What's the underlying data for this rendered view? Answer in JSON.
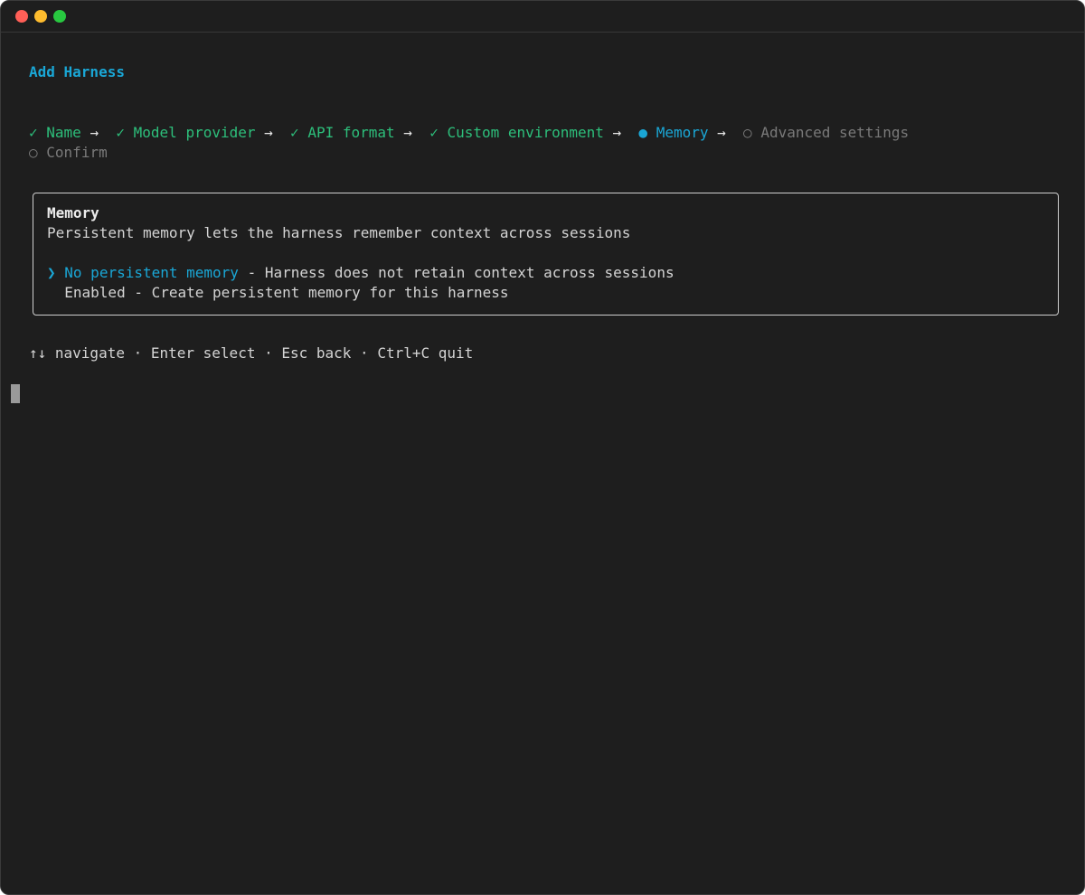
{
  "window": {
    "traffic_lights": [
      "close",
      "minimize",
      "maximize"
    ]
  },
  "title": "Add Harness",
  "steps": [
    {
      "icon": "✓",
      "label": "Name",
      "state": "done"
    },
    {
      "icon": "✓",
      "label": "Model provider",
      "state": "done"
    },
    {
      "icon": "✓",
      "label": "API format",
      "state": "done"
    },
    {
      "icon": "✓",
      "label": "Custom environment",
      "state": "done"
    },
    {
      "icon": "●",
      "label": "Memory",
      "state": "current"
    },
    {
      "icon": "○",
      "label": "Advanced settings",
      "state": "pending"
    },
    {
      "icon": "○",
      "label": "Confirm",
      "state": "pending"
    }
  ],
  "separator": "→",
  "panel": {
    "heading": "Memory",
    "description": "Persistent memory lets the harness remember context across sessions",
    "pointer": "❯",
    "options": [
      {
        "label": "No persistent memory",
        "desc": " - Harness does not retain context across sessions",
        "selected": true
      },
      {
        "label": "Enabled",
        "desc": " - Create persistent memory for this harness",
        "selected": false
      }
    ]
  },
  "help": "↑↓ navigate · Enter select · Esc back · Ctrl+C quit",
  "colors": {
    "done": "#2dbf7b",
    "current": "#1aa7d6",
    "pending": "#7a7a7a",
    "background": "#1e1e1e"
  }
}
